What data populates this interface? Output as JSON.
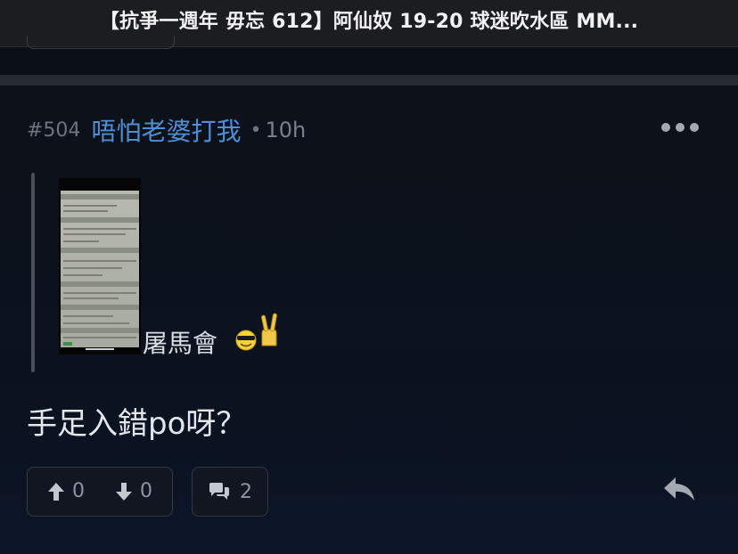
{
  "header": {
    "title": "【抗爭一週年 毋忘 612】阿仙奴 19-20 球迷吹水區 MM..."
  },
  "post": {
    "number": "#504",
    "author": "唔怕老婆打我",
    "separator": "•",
    "time": "10h",
    "quote": {
      "text": "屠馬會",
      "image_icon": "photo-of-phone-screen",
      "emojis": [
        "cool-face-icon",
        "rock-hand-icon"
      ]
    },
    "body": "手足入錯po呀？",
    "upvotes": "0",
    "downvotes": "0",
    "comments": "2"
  },
  "colors": {
    "author": "#4d8fd6",
    "background": "#0b0f17",
    "topbar": "#1c1d21"
  },
  "icons": {
    "more": "more-dots-icon",
    "upvote": "arrow-up-icon",
    "downvote": "arrow-down-icon",
    "comment": "comment-bubbles-icon",
    "reply": "reply-icon"
  }
}
